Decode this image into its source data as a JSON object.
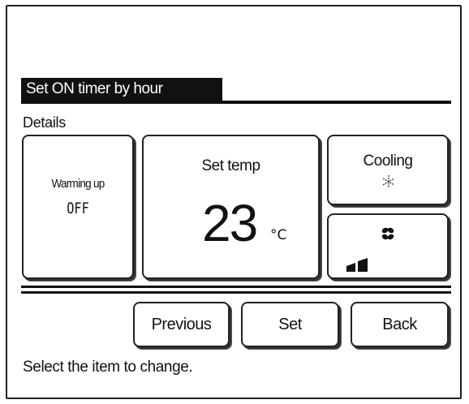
{
  "screen": {
    "title": "Set ON timer by hour",
    "section_label": "Details"
  },
  "tiles": {
    "warming_up": {
      "label": "Warming up",
      "value": "OFF"
    },
    "set_temp": {
      "label": "Set temp",
      "value": "23",
      "unit": "°C"
    },
    "mode": {
      "label": "Cooling",
      "icon": "snowflake-icon"
    },
    "fan": {
      "icon": "fan-icon",
      "level_icon": "fan-level-icon",
      "level": 2,
      "level_max": 2
    }
  },
  "buttons": {
    "previous": "Previous",
    "set": "Set",
    "back": "Back"
  },
  "status": {
    "message": "Select the item to change."
  }
}
